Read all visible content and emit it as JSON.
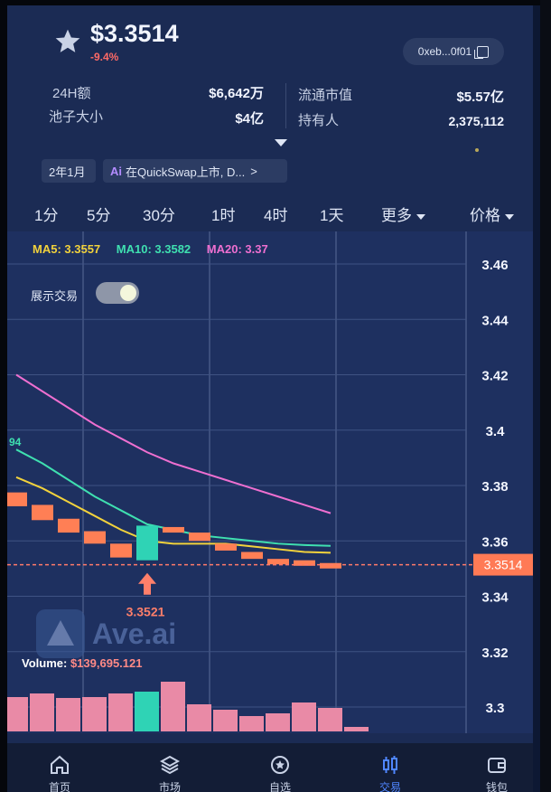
{
  "token": {
    "price": "$3.3514",
    "change": "-9.4%",
    "address": "0xeb...0f01"
  },
  "stats": {
    "volume_24h_label": "24H额",
    "volume_24h_value": "$6,642万",
    "pool_label": "池子大小",
    "pool_value": "$4亿",
    "mcap_label": "流通市值",
    "mcap_value": "$5.57亿",
    "holders_label": "持有人",
    "holders_value": "2,375,112"
  },
  "chips": {
    "date": "2年1月",
    "ai_badge": "Ai",
    "listing": "在QuickSwap上市, D...",
    "listing_arrow": ">"
  },
  "timeframes": [
    "1分",
    "5分",
    "30分",
    "1时",
    "4时",
    "1天"
  ],
  "more_label": "更多",
  "price_label": "价格",
  "ma_legend": {
    "ma5": "MA5: 3.3557",
    "ma10": "MA10: 3.3582",
    "ma20": "MA20: 3.37",
    "ma10_edge": "94"
  },
  "toggle_label": "展示交易",
  "watermark": "Ave.ai",
  "volume_label": "Volume:",
  "volume_value": "$139,695.121",
  "trade_marker_label": "3.3521",
  "current_price_tag": "3.3514",
  "colors": {
    "up": "#2fd3b5",
    "down": "#ff7f55",
    "ma5": "#f2d23c",
    "ma10": "#3fe0b0",
    "ma20": "#ee6fd0",
    "accent": "#4f86ff",
    "volume": "#e98aa6"
  },
  "nav": [
    {
      "label": "首页",
      "icon": "home-icon"
    },
    {
      "label": "市场",
      "icon": "layers-icon"
    },
    {
      "label": "自选",
      "icon": "star-circle-icon"
    },
    {
      "label": "交易",
      "icon": "candles-icon"
    },
    {
      "label": "钱包",
      "icon": "wallet-icon"
    }
  ],
  "chart_data": {
    "type": "candlestick",
    "ylim": [
      3.29,
      3.47
    ],
    "yticks": [
      "3.46",
      "3.44",
      "3.42",
      "3.4",
      "3.38",
      "3.36",
      "3.34",
      "3.32",
      "3.3"
    ],
    "current_price": 3.3514,
    "candles": [
      {
        "open": 3.3775,
        "close": 3.3725
      },
      {
        "open": 3.373,
        "close": 3.3675
      },
      {
        "open": 3.368,
        "close": 3.363
      },
      {
        "open": 3.3635,
        "close": 3.359
      },
      {
        "open": 3.359,
        "close": 3.354
      },
      {
        "open": 3.353,
        "close": 3.3655
      },
      {
        "open": 3.365,
        "close": 3.363
      },
      {
        "open": 3.363,
        "close": 3.36
      },
      {
        "open": 3.359,
        "close": 3.3565
      },
      {
        "open": 3.356,
        "close": 3.3535
      },
      {
        "open": 3.3535,
        "close": 3.3518
      },
      {
        "open": 3.353,
        "close": 3.351
      },
      {
        "open": 3.352,
        "close": 3.3505
      }
    ],
    "ma5": [
      3.383,
      3.379,
      3.374,
      3.369,
      3.364,
      3.36,
      3.359,
      3.359,
      3.359,
      3.358,
      3.357,
      3.356,
      3.3557
    ],
    "ma10": [
      3.393,
      3.388,
      3.382,
      3.376,
      3.371,
      3.366,
      3.364,
      3.362,
      3.361,
      3.36,
      3.359,
      3.3585,
      3.3582
    ],
    "ma20": [
      3.42,
      3.414,
      3.408,
      3.402,
      3.397,
      3.392,
      3.388,
      3.385,
      3.382,
      3.379,
      3.376,
      3.373,
      3.37
    ],
    "volumes": [
      38,
      42,
      37,
      38,
      42,
      44,
      55,
      30,
      24,
      17,
      20,
      32,
      26,
      5
    ]
  }
}
